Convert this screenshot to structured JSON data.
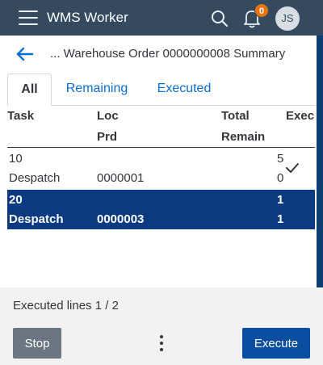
{
  "shell": {
    "title": "WMS Worker",
    "notification_count": "0",
    "avatar_initials": "JS",
    "icons": [
      "menu-icon",
      "search-icon",
      "bell-icon"
    ]
  },
  "page": {
    "title": "... Warehouse Order 0000000008 Summary"
  },
  "tabs": [
    {
      "label": "All",
      "selected": true
    },
    {
      "label": "Remaining",
      "selected": false
    },
    {
      "label": "Executed",
      "selected": false
    }
  ],
  "table": {
    "columns": {
      "task": "Task",
      "loc": "Loc",
      "prd": "Prd",
      "total": "Total",
      "remain": "Remain",
      "exec": "Exec"
    },
    "rows": [
      {
        "task_no": "10",
        "task_type": "Despatch",
        "loc": "",
        "product": "0000001",
        "total": "5",
        "remain": "0",
        "executed": true,
        "selected": false
      },
      {
        "task_no": "20",
        "task_type": "Despatch",
        "loc": "",
        "product": "0000003",
        "total": "1",
        "remain": "1",
        "executed": false,
        "selected": true
      }
    ]
  },
  "footer": {
    "status": "Executed lines 1 / 2",
    "stop_label": "Stop",
    "execute_label": "Execute"
  },
  "colors": {
    "shell_bar": "#354a5f",
    "badge": "#e9730c",
    "selected_row": "#0a3a82",
    "frame": "#0b3f70",
    "accent_orange": "#f0a830",
    "execute_button": "#0a4ea0",
    "stop_button": "#6a7681"
  }
}
